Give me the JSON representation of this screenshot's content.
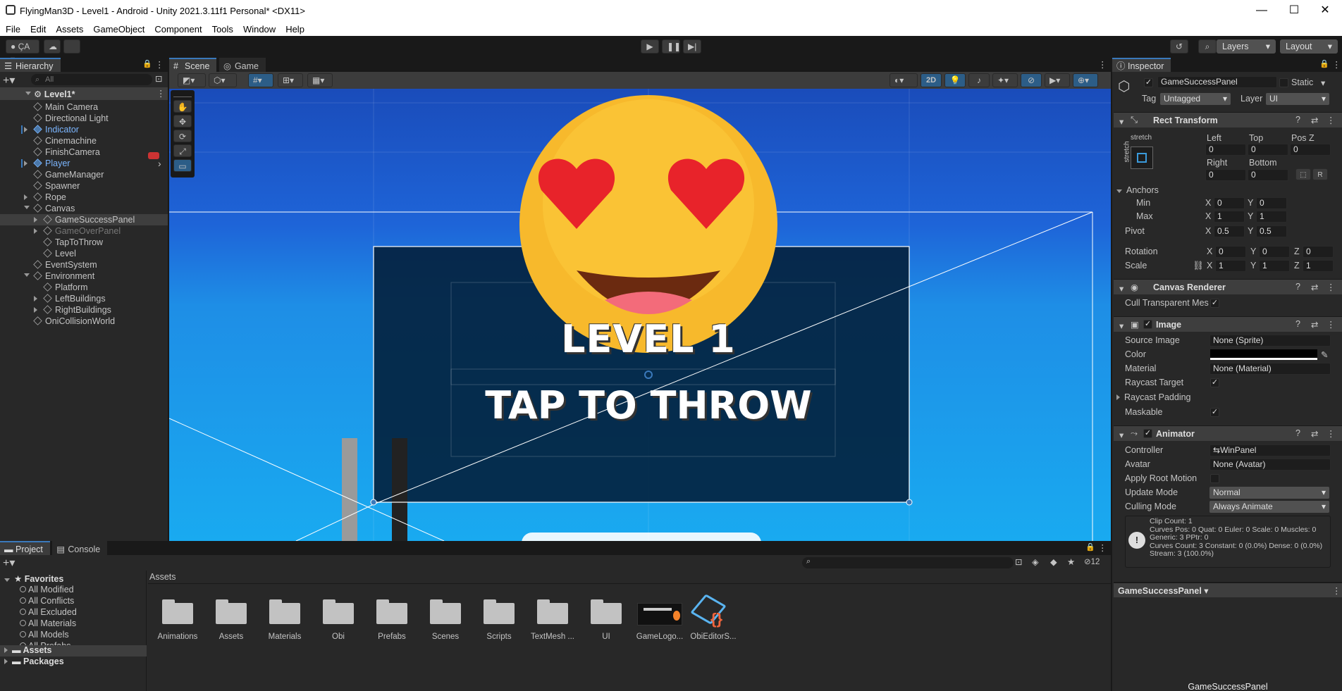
{
  "window": {
    "title": "FlyingMan3D - Level1 - Android - Unity 2021.3.11f1 Personal* <DX11>"
  },
  "menu": [
    "File",
    "Edit",
    "Assets",
    "GameObject",
    "Component",
    "Tools",
    "Window",
    "Help"
  ],
  "toolbar": {
    "account": "ÇA",
    "layers": "Layers",
    "layout": "Layout"
  },
  "hierarchy": {
    "tab": "Hierarchy",
    "search_placeholder": "All",
    "scene": "Level1*",
    "items": [
      {
        "label": "Main Camera",
        "indent": 0
      },
      {
        "label": "Directional Light",
        "indent": 0
      },
      {
        "label": "Indicator",
        "indent": 0,
        "prefab": true,
        "expandable": true
      },
      {
        "label": "Cinemachine",
        "indent": 0
      },
      {
        "label": "FinishCamera",
        "indent": 0
      },
      {
        "label": "Player",
        "indent": 0,
        "prefab": true,
        "expandable": true
      },
      {
        "label": "GameManager",
        "indent": 0
      },
      {
        "label": "Spawner",
        "indent": 0
      },
      {
        "label": "Rope",
        "indent": 0,
        "expandable": true
      },
      {
        "label": "Canvas",
        "indent": 0,
        "expanded": true
      },
      {
        "label": "GameSuccessPanel",
        "indent": 1,
        "expandable": true,
        "selected": true
      },
      {
        "label": "GameOverPanel",
        "indent": 1,
        "expandable": true,
        "disabled": true
      },
      {
        "label": "TapToThrow",
        "indent": 1
      },
      {
        "label": "Level",
        "indent": 1
      },
      {
        "label": "EventSystem",
        "indent": 0
      },
      {
        "label": "Environment",
        "indent": 0,
        "expanded": true
      },
      {
        "label": "Platform",
        "indent": 1
      },
      {
        "label": "LeftBuildings",
        "indent": 1,
        "expandable": true
      },
      {
        "label": "RightBuildings",
        "indent": 1,
        "expandable": true
      },
      {
        "label": "OniCollisionWorld",
        "indent": 0
      }
    ]
  },
  "scene": {
    "tabs": [
      "Scene",
      "Game"
    ],
    "mode_2d": "2D",
    "level_text": "LEVEL 1",
    "tap_text": "TAP TO THROW"
  },
  "inspector": {
    "tab": "Inspector",
    "object_name": "GameSuccessPanel",
    "static_label": "Static",
    "tag_label": "Tag",
    "tag": "Untagged",
    "layer_label": "Layer",
    "layer": "UI",
    "rect_transform": {
      "title": "Rect Transform",
      "anchor_preset": "stretch",
      "left_label": "Left",
      "top_label": "Top",
      "posz_label": "Pos Z",
      "left": "0",
      "top": "0",
      "posz": "0",
      "right_label": "Right",
      "bottom_label": "Bottom",
      "right": "0",
      "bottom": "0",
      "anchors_label": "Anchors",
      "min_label": "Min",
      "min_x": "0",
      "min_y": "0",
      "max_label": "Max",
      "max_x": "1",
      "max_y": "1",
      "pivot_label": "Pivot",
      "pivot_x": "0.5",
      "pivot_y": "0.5",
      "rotation_label": "Rotation",
      "rot_x": "0",
      "rot_y": "0",
      "rot_z": "0",
      "scale_label": "Scale",
      "scale_x": "1",
      "scale_y": "1",
      "scale_z": "1",
      "raw_button": "R"
    },
    "canvas_renderer": {
      "title": "Canvas Renderer",
      "cull_label": "Cull Transparent Mes"
    },
    "image": {
      "title": "Image",
      "source_label": "Source Image",
      "source": "None (Sprite)",
      "color_label": "Color",
      "material_label": "Material",
      "material": "None (Material)",
      "raycast_label": "Raycast Target",
      "padding_label": "Raycast Padding",
      "maskable_label": "Maskable"
    },
    "animator": {
      "title": "Animator",
      "controller_label": "Controller",
      "controller": "WinPanel",
      "avatar_label": "Avatar",
      "avatar": "None (Avatar)",
      "root_label": "Apply Root Motion",
      "update_label": "Update Mode",
      "update": "Normal",
      "culling_label": "Culling Mode",
      "culling": "Always Animate",
      "info": [
        "Clip Count: 1",
        "Curves Pos: 0 Quat: 0 Euler: 0 Scale: 0 Muscles: 0",
        "Generic: 3 PPtr: 0",
        "Curves Count: 3 Constant: 0 (0.0%) Dense: 0 (0.0%)",
        "Stream: 3 (100.0%)"
      ]
    },
    "preview_dropdown": "GameSuccessPanel",
    "preview_label": "GameSuccessPanel"
  },
  "project": {
    "tabs": [
      "Project",
      "Console"
    ],
    "hidden_count": "12",
    "favorites_label": "Favorites",
    "favorites": [
      "All Modified",
      "All Conflicts",
      "All Excluded",
      "All Materials",
      "All Models",
      "All Prefabs"
    ],
    "roots": [
      "Assets",
      "Packages"
    ],
    "breadcrumb": "Assets",
    "assets": [
      "Animations",
      "Assets",
      "Materials",
      "Obi",
      "Prefabs",
      "Scenes",
      "Scripts",
      "TextMesh ...",
      "UI",
      "GameLogo...",
      "ObiEditorS..."
    ]
  },
  "colors": {
    "accent": "#3a79bb",
    "selection": "#2c5d87",
    "scene_sky": "#1e78e6"
  }
}
